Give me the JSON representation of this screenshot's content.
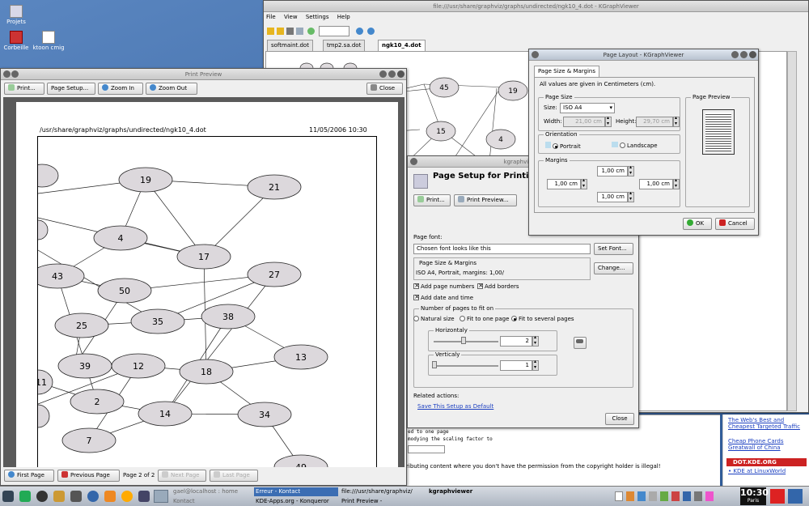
{
  "desktop": {
    "icons": [
      {
        "label": "Projets",
        "icon": "folder-icon"
      },
      {
        "label": "Corbeille",
        "icon": "trash-icon"
      },
      {
        "label": "ktoon cmig",
        "icon": "file-icon"
      }
    ]
  },
  "kgraph": {
    "title": "file:///usr/share/graphviz/graphs/undirected/ngk10_4.dot - KGraphViewer",
    "menu": [
      "File",
      "View",
      "Settings",
      "Help"
    ],
    "tabs": [
      "softmaint.dot",
      "tmp2.sa.dot",
      "ngk10_4.dot"
    ],
    "visible_nodes": [
      "45",
      "19",
      "15",
      "4"
    ]
  },
  "preview": {
    "title": "Print Preview",
    "toolbar": {
      "print": "Print...",
      "page_setup": "Page Setup...",
      "zoom_in": "Zoom In",
      "zoom_out": "Zoom Out",
      "close": "Close"
    },
    "header_path": "/usr/share/graphviz/graphs/undirected/ngk10_4.dot",
    "header_date": "11/05/2006 10:30",
    "nodes": [
      "19",
      "21",
      "4",
      "17",
      "43",
      "50",
      "27",
      "25",
      "35",
      "38",
      "13",
      "39",
      "12",
      "18",
      "11",
      "2",
      "14",
      "34",
      "7",
      "49"
    ],
    "bottom": {
      "first": "First Page",
      "previous": "Previous Page",
      "page": "Page 2 of 2",
      "next": "Next Page",
      "last": "Last Page"
    }
  },
  "setup": {
    "title": "kgraphviewer",
    "heading": "Page Setup for Printing \"ngk10_4.dot\"",
    "print": "Print...",
    "print_preview": "Print Preview...",
    "page_font_label": "Page font:",
    "font_sample": "Chosen font looks like this",
    "set_font": "Set Font...",
    "size_group": "Page Size & Margins",
    "size_summary": "ISO A4, Portrait, margins: 1,00/",
    "change": "Change...",
    "add_page_numbers": "Add page numbers",
    "add_borders": "Add borders",
    "add_date": "Add date and time",
    "pages_group": "Number of pages to fit on",
    "natural": "Natural size",
    "fit_one": "Fit to one page",
    "fit_several": "Fit to several pages",
    "horizontaly": "Horizontaly",
    "h_value": "2",
    "verticaly": "Verticaly",
    "v_value": "1",
    "related": "Related actions:",
    "save_default": "Save This Setup as Default",
    "close": "Close"
  },
  "layout": {
    "title": "Page Layout - KGraphViewer",
    "tab": "Page Size & Margins",
    "info": "All values are given in Centimeters (cm).",
    "page_size_group": "Page Size",
    "size_label": "Size:",
    "size_value": "ISO A4",
    "width_label": "Width:",
    "width_value": "21,00 cm",
    "height_label": "Height:",
    "height_value": "29,70 cm",
    "orientation_group": "Orientation",
    "portrait": "Portrait",
    "landscape": "Landscape",
    "margins_group": "Margins",
    "margin_top": "1,00 cm",
    "margin_left": "1,00 cm",
    "margin_right": "1,00 cm",
    "margin_bottom": "1,00 cm",
    "preview_group": "Page Preview",
    "ok": "OK",
    "cancel": "Cancel"
  },
  "browser": {
    "ads": [
      "The Web's Best and Cheapest Targeted Traffic",
      "Cheap Phone Cards",
      "Greatwall of China"
    ],
    "dot_header": "DOT.KDE.ORG",
    "kde_link": "• KDE at LinuxWorld",
    "code_lines": [
      "ed to one page",
      "modying the scaling factor to"
    ],
    "bottom_text": "ributing content where you don't have the permission from the copyright holder is illegal!"
  },
  "taskbar": {
    "tasks": [
      "gael@localhost : home",
      "Erreur - Kontact",
      "file:///usr/share/graphviz/",
      "kgraphviewer",
      "Kontact",
      "KDE-Apps.org - Konqueror",
      "Print Preview -"
    ],
    "clock": "10:30",
    "clock_sub": "Paris"
  }
}
